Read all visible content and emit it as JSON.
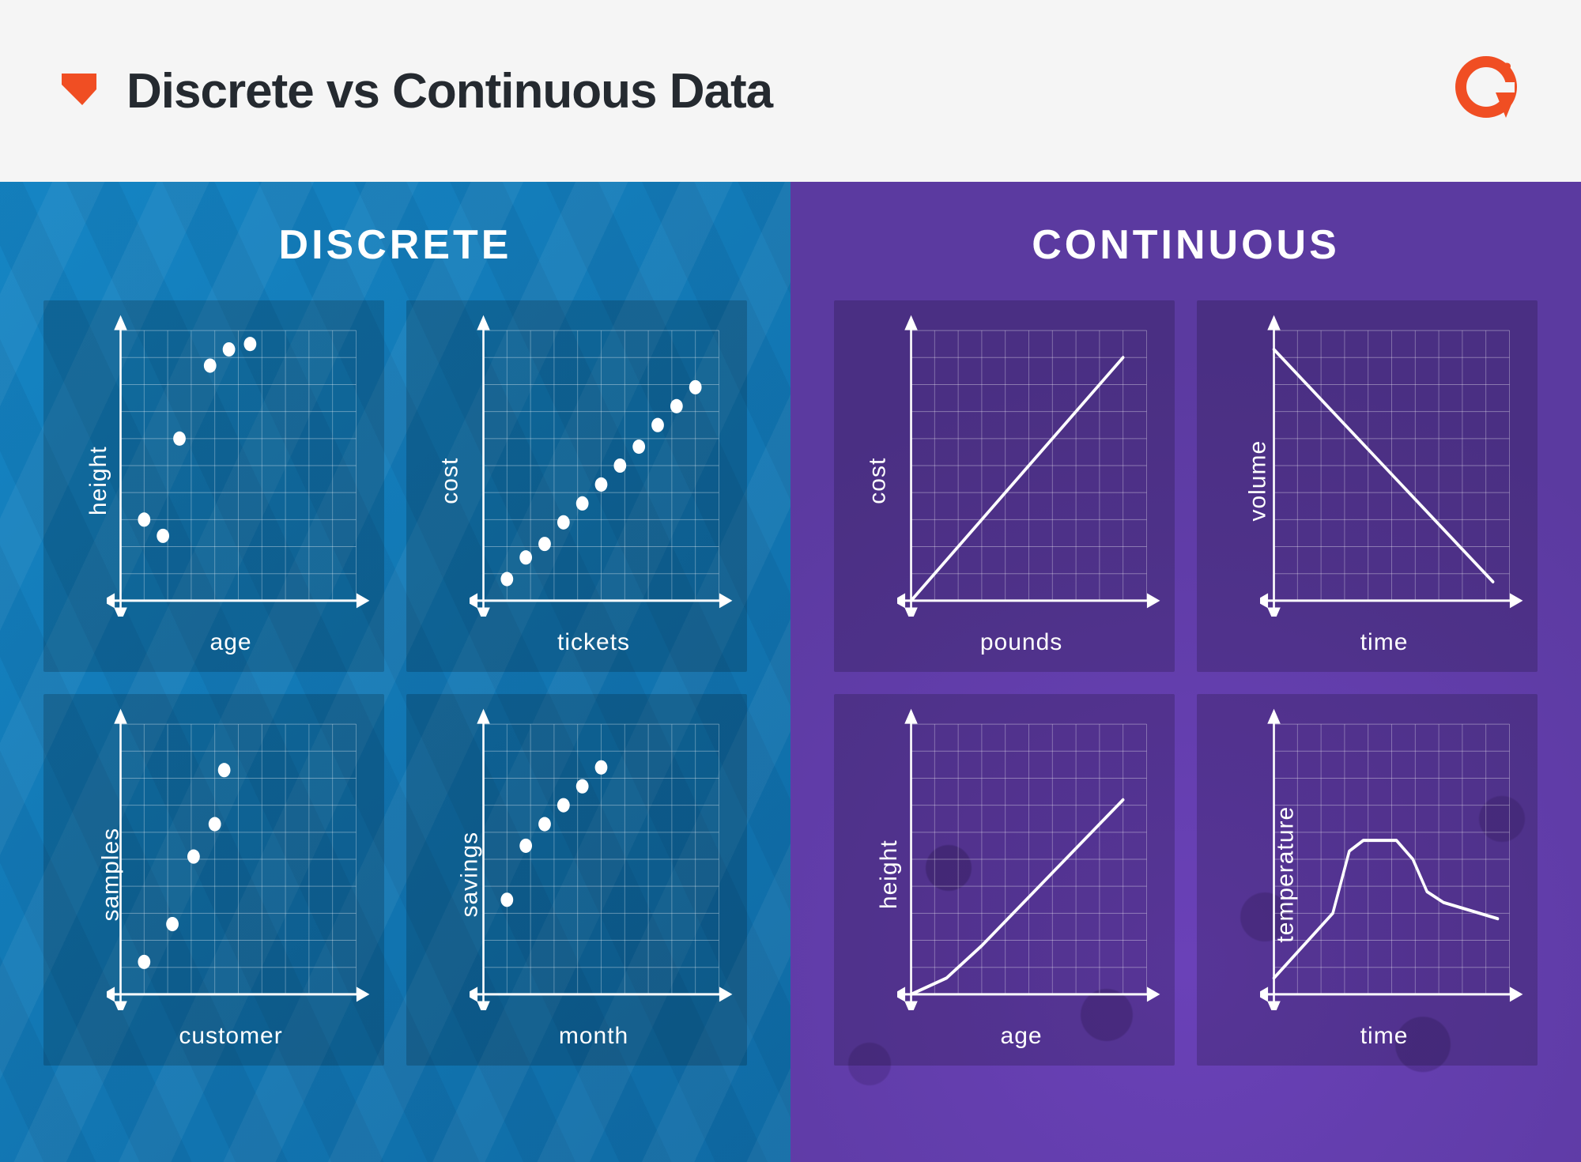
{
  "header": {
    "title": "Discrete vs Continuous Data",
    "brand": "G2",
    "brand_super": "2"
  },
  "panels": {
    "discrete": {
      "title": "DISCRETE"
    },
    "continuous": {
      "title": "CONTINUOUS"
    }
  },
  "chart_data": [
    {
      "id": "discrete-1",
      "type": "scatter",
      "panel": "discrete",
      "xlabel": "age",
      "ylabel": "height",
      "xlim": [
        0,
        10
      ],
      "ylim": [
        0,
        10
      ],
      "points": [
        {
          "x": 1.0,
          "y": 3.0
        },
        {
          "x": 1.8,
          "y": 2.4
        },
        {
          "x": 2.5,
          "y": 6.0
        },
        {
          "x": 3.8,
          "y": 8.7
        },
        {
          "x": 4.6,
          "y": 9.3
        },
        {
          "x": 5.5,
          "y": 9.5
        }
      ]
    },
    {
      "id": "discrete-2",
      "type": "scatter",
      "panel": "discrete",
      "xlabel": "tickets",
      "ylabel": "cost",
      "xlim": [
        0,
        10
      ],
      "ylim": [
        0,
        10
      ],
      "points": [
        {
          "x": 1.0,
          "y": 0.8
        },
        {
          "x": 1.8,
          "y": 1.6
        },
        {
          "x": 2.6,
          "y": 2.1
        },
        {
          "x": 3.4,
          "y": 2.9
        },
        {
          "x": 4.2,
          "y": 3.6
        },
        {
          "x": 5.0,
          "y": 4.3
        },
        {
          "x": 5.8,
          "y": 5.0
        },
        {
          "x": 6.6,
          "y": 5.7
        },
        {
          "x": 7.4,
          "y": 6.5
        },
        {
          "x": 8.2,
          "y": 7.2
        },
        {
          "x": 9.0,
          "y": 7.9
        }
      ]
    },
    {
      "id": "discrete-3",
      "type": "scatter",
      "panel": "discrete",
      "xlabel": "customer",
      "ylabel": "samples",
      "xlim": [
        0,
        10
      ],
      "ylim": [
        0,
        10
      ],
      "points": [
        {
          "x": 1.0,
          "y": 1.2
        },
        {
          "x": 2.2,
          "y": 2.6
        },
        {
          "x": 3.1,
          "y": 5.1
        },
        {
          "x": 4.0,
          "y": 6.3
        },
        {
          "x": 4.4,
          "y": 8.3
        }
      ]
    },
    {
      "id": "discrete-4",
      "type": "scatter",
      "panel": "discrete",
      "xlabel": "month",
      "ylabel": "savings",
      "xlim": [
        0,
        10
      ],
      "ylim": [
        0,
        10
      ],
      "points": [
        {
          "x": 1.0,
          "y": 3.5
        },
        {
          "x": 1.8,
          "y": 5.5
        },
        {
          "x": 2.6,
          "y": 6.3
        },
        {
          "x": 3.4,
          "y": 7.0
        },
        {
          "x": 4.2,
          "y": 7.7
        },
        {
          "x": 5.0,
          "y": 8.4
        }
      ]
    },
    {
      "id": "continuous-1",
      "type": "line",
      "panel": "continuous",
      "xlabel": "pounds",
      "ylabel": "cost",
      "xlim": [
        0,
        10
      ],
      "ylim": [
        0,
        10
      ],
      "path": [
        {
          "x": 0.0,
          "y": 0.0
        },
        {
          "x": 9.0,
          "y": 9.0
        }
      ]
    },
    {
      "id": "continuous-2",
      "type": "line",
      "panel": "continuous",
      "xlabel": "time",
      "ylabel": "volume",
      "xlim": [
        0,
        10
      ],
      "ylim": [
        0,
        10
      ],
      "path": [
        {
          "x": 0.0,
          "y": 9.3
        },
        {
          "x": 9.3,
          "y": 0.7
        }
      ]
    },
    {
      "id": "continuous-3",
      "type": "line",
      "panel": "continuous",
      "xlabel": "age",
      "ylabel": "height",
      "xlim": [
        0,
        10
      ],
      "ylim": [
        0,
        10
      ],
      "path": [
        {
          "x": 0.0,
          "y": 0.0
        },
        {
          "x": 1.5,
          "y": 0.6
        },
        {
          "x": 3.0,
          "y": 1.8
        },
        {
          "x": 9.0,
          "y": 7.2
        }
      ]
    },
    {
      "id": "continuous-4",
      "type": "line",
      "panel": "continuous",
      "xlabel": "time",
      "ylabel": "temperature",
      "xlim": [
        0,
        10
      ],
      "ylim": [
        0,
        10
      ],
      "path": [
        {
          "x": 0.0,
          "y": 0.6
        },
        {
          "x": 2.5,
          "y": 3.0
        },
        {
          "x": 3.2,
          "y": 5.3
        },
        {
          "x": 3.8,
          "y": 5.7
        },
        {
          "x": 5.2,
          "y": 5.7
        },
        {
          "x": 5.9,
          "y": 5.0
        },
        {
          "x": 6.5,
          "y": 3.8
        },
        {
          "x": 7.2,
          "y": 3.4
        },
        {
          "x": 9.5,
          "y": 2.8
        }
      ]
    }
  ],
  "colors": {
    "accent": "#f04e23",
    "discrete_bg": "#1585c4",
    "continuous_bg": "#5f3ea8",
    "stroke": "#ffffff"
  }
}
